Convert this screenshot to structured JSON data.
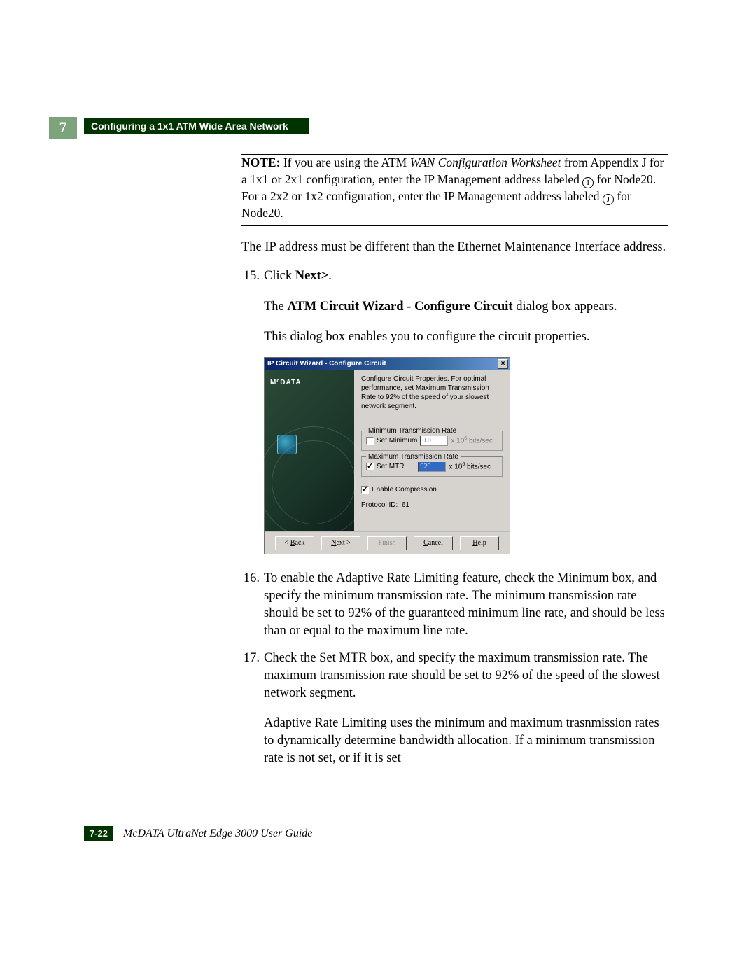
{
  "chapter_number": "7",
  "section_title": "Configuring a 1x1 ATM Wide Area Network",
  "note": {
    "line1_pre": "NOTE:",
    "line1_mid": " If you are using the ATM ",
    "line1_italic": "WAN Configuration Worksheet",
    "line1_post": " from Appendix J for a 1x1 or 2x1 configuration, enter the IP Management address labeled ",
    "circ1": "I",
    "line1_end": " for Node20.",
    "line2_pre": "For a 2x2 or 1x2 configuration, enter the IP Management address labeled ",
    "circ2": "J",
    "line2_end": " for Node20."
  },
  "para_ip": "The IP address must be different than the Ethernet Maintenance Interface address.",
  "steps": {
    "s15_num": "15.",
    "s15_text_pre": "Click ",
    "s15_bold": "Next>",
    "s15_text_post": ".",
    "s15_result_pre": "The ",
    "s15_result_bold": "ATM Circuit Wizard - Configure Circuit",
    "s15_result_post": " dialog box appears.",
    "s15_hint": "This dialog box enables you to configure the circuit properties.",
    "s16_num": "16.",
    "s16_text": "To enable the Adaptive Rate Limiting feature, check the Minimum box, and specify the minimum transmission rate. The minimum transmission rate should be set to 92% of the guaranteed minimum line rate, and should be less than or equal to the maximum line rate.",
    "s17_num": "17.",
    "s17_text": "Check the Set MTR box, and specify the maximum transmission rate. The maximum transmission rate should be set to 92% of the speed of the slowest network segment.",
    "s17_para2": "Adaptive Rate Limiting uses the minimum and maximum trasnmission rates to dynamically determine bandwidth allocation. If a minimum transmission rate is not set, or if it is set"
  },
  "dialog": {
    "title": "IP Circuit Wizard - Configure Circuit",
    "close": "×",
    "logo_pre": "M",
    "logo_sup": "c",
    "logo_post": "DATA",
    "instr": "Configure Circuit Properties. For optimal performance, set Maximum Transmission Rate to 92% of the speed of your slowest network segment.",
    "min_legend": "Minimum Transmission Rate",
    "min_label": "Set Minimum",
    "min_value": "0.0",
    "unit_pre": "x 10",
    "unit_sup": "6",
    "unit_post": " bits/sec",
    "max_legend": "Maximum Transmission Rate",
    "max_label": "Set MTR",
    "max_value": "920",
    "enable_comp": "Enable Compression",
    "proto_label": "Protocol ID:",
    "proto_value": "61",
    "btn_back": "< Back",
    "btn_next": "Next >",
    "btn_finish": "Finish",
    "btn_cancel": "Cancel",
    "btn_help": "Help"
  },
  "footer": {
    "page": "7-22",
    "guide": "McDATA UltraNet Edge 3000 User Guide"
  }
}
